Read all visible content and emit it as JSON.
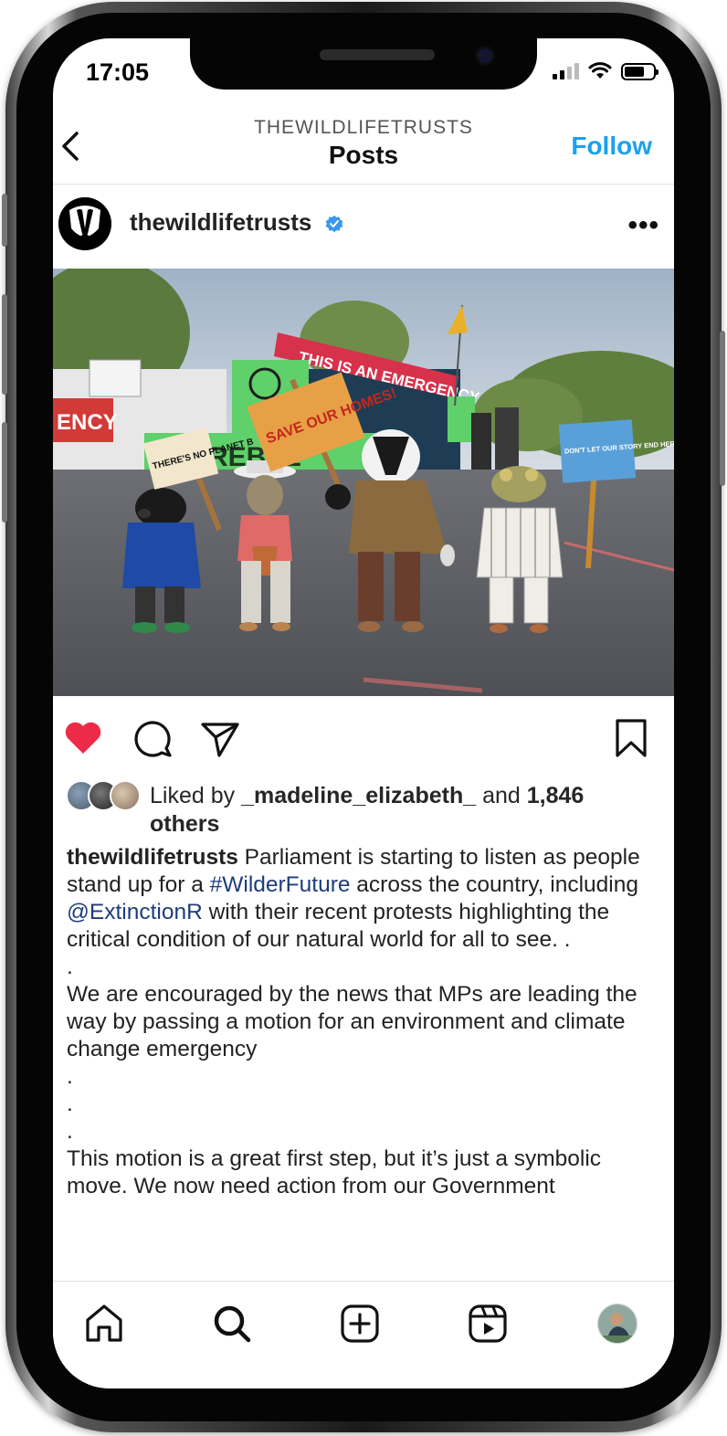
{
  "status_bar": {
    "time": "17:05"
  },
  "header": {
    "username": "THEWILDLIFETRUSTS",
    "title": "Posts",
    "follow_label": "Follow"
  },
  "post": {
    "username": "thewildlifetrusts",
    "verified": true,
    "liked_by_prefix": "Liked by ",
    "liked_by_user": "_madeline_elizabeth_",
    "liked_by_and": " and ",
    "liked_by_count": "1,846 others",
    "caption": {
      "username": "thewildlifetrusts",
      "p1_a": " Parliament is starting to listen as people stand up for a ",
      "hashtag": "#WilderFuture",
      "p1_b": " across the country, including ",
      "mention": "@ExtinctionR",
      "p1_c": " with their recent protests highlighting the critical condition of our natural world for all to see. .",
      "dot1": ".",
      "p2": "We are encouraged by the news that MPs are leading the way by passing a motion for an environment and climate change emergency",
      "dot2": ".",
      "dot3": ".",
      "dot4": ".",
      "p3": "This motion is a great first step, but it’s just a symbolic move. We now need action from our Government"
    }
  },
  "photo_signs": {
    "banner": "THIS IS AN EMERGENCY",
    "sign_left": "THERE'S NO PLANET B",
    "sign_center": "SAVE OUR HOMES!",
    "sign_right": "DON'T LET OUR STORY END HERE",
    "side_banner": "ENCY",
    "rebel": "REBEL"
  },
  "colors": {
    "accent": "#1aa1f0",
    "like": "#ed2b48",
    "link": "#1d3d7a"
  },
  "icons": {
    "back": "chevron-left-icon",
    "more": "more-icon",
    "like": "heart-icon",
    "comment": "comment-icon",
    "share": "share-icon",
    "save": "bookmark-icon",
    "home": "home-icon",
    "search": "search-icon",
    "create": "plus-square-icon",
    "reels": "reels-icon"
  }
}
